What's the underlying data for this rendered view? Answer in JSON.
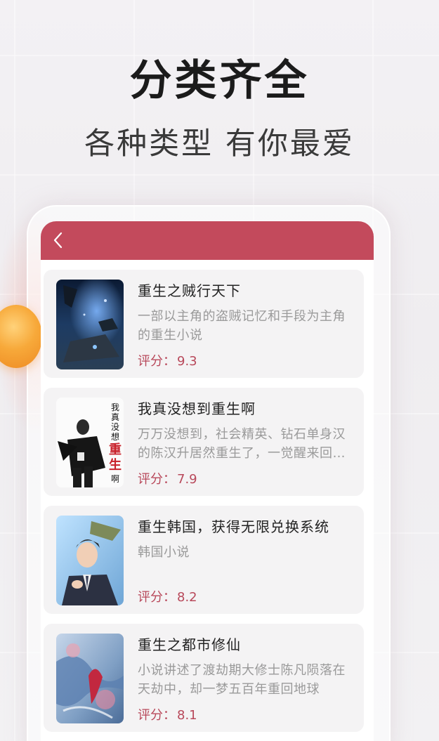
{
  "headline": "分类齐全",
  "subline": "各种类型 有你最爱",
  "colors": {
    "accent": "#c34a5c",
    "score": "#b8485a"
  },
  "navbar": {
    "back_icon": "chevron-left-icon"
  },
  "score_label": "评分：",
  "books": [
    {
      "title": "重生之贼行天下",
      "desc": "一部以主角的盗贼记忆和手段为主角的重生小说",
      "score": "9.3",
      "cover": "space-scene-cover"
    },
    {
      "title": "我真没想到重生啊",
      "desc": "万万没想到，社会精英、钻石单身汉的陈汉升居然重生了，一觉醒来回到了高考完的那个暑假",
      "score": "7.9",
      "cover": "suit-man-calligraphy-cover",
      "cover_text": "我真没想重生啊"
    },
    {
      "title": "重生韩国，获得无限兑换系统",
      "desc": "韩国小说",
      "score": "8.2",
      "cover": "businessman-cover"
    },
    {
      "title": "重生之都市修仙",
      "desc": "小说讲述了渡劫期大修士陈凡陨落在天劫中，却一梦五百年重回地球",
      "score": "8.1",
      "cover": "fantasy-art-cover"
    }
  ]
}
